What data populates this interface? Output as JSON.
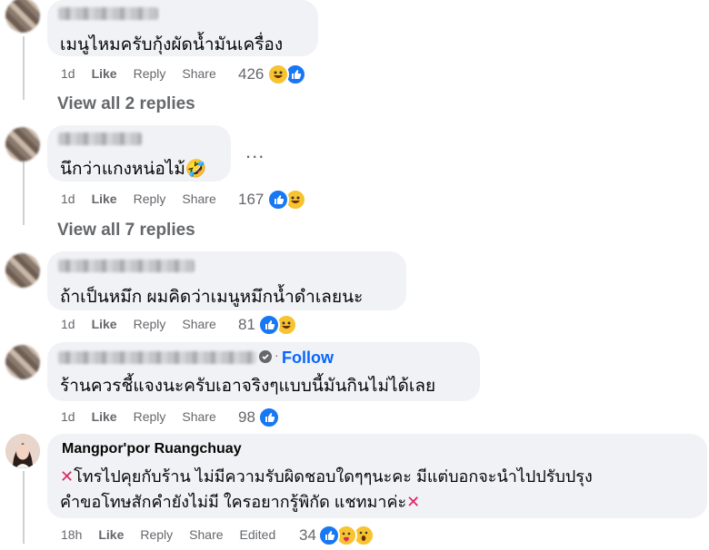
{
  "comments": [
    {
      "text": "เมนูไหมครับกุ้งผัดน้ำมันเครื่อง",
      "time": "1d",
      "like": "Like",
      "reply": "Reply",
      "share": "Share",
      "reactions_count": "426",
      "reactions": [
        "haha-icon",
        "like-icon"
      ],
      "view_replies": "View all 2 replies"
    },
    {
      "text": "นึกว่าแกงหน่อไม้🤣",
      "time": "1d",
      "like": "Like",
      "reply": "Reply",
      "share": "Share",
      "reactions_count": "167",
      "reactions": [
        "like-icon",
        "haha-icon"
      ],
      "more": "...",
      "view_replies": "View all 7 replies"
    },
    {
      "text": "ถ้าเป็นหมึก ผมคิดว่าเมนูหมึกน้ำดำเลยนะ",
      "time": "1d",
      "like": "Like",
      "reply": "Reply",
      "share": "Share",
      "reactions_count": "81",
      "reactions": [
        "like-icon",
        "haha-icon"
      ]
    },
    {
      "follow": "Follow",
      "text": "ร้านควรชี้แจงนะครับเอาจริงๆแบบนี้มันกินไม่ได้เลย",
      "time": "1d",
      "like": "Like",
      "reply": "Reply",
      "share": "Share",
      "reactions_count": "98",
      "reactions": [
        "like-icon"
      ]
    },
    {
      "author": "Mangpor'por Ruangchuay",
      "line1": "โทรไปคุยกับร้าน ไม่มีความรับผิดชอบใดๆๆนะคะ มีแต่บอกจะนำไปปรับปรุง",
      "line2": "คำขอโทษสักคำยังไม่มี ใครอยากรู้พิกัด แชทมาค่ะ",
      "time": "18h",
      "like": "Like",
      "reply": "Reply",
      "share": "Share",
      "edited": "Edited",
      "reactions_count": "34",
      "reactions": [
        "like-icon",
        "care-icon",
        "wow-icon"
      ]
    }
  ],
  "colors": {
    "like": "#1877f2",
    "muted": "#65676b",
    "bubble": "#f0f2f5",
    "follow": "#0866ff",
    "x": "#e0245e"
  }
}
